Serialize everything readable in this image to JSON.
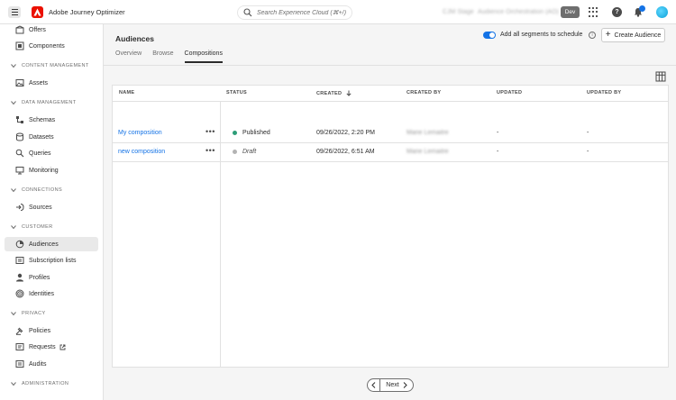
{
  "topbar": {
    "app_title": "Adobe Journey Optimizer",
    "search_placeholder": "Search Experience Cloud (⌘+/)",
    "org_name": "CJM Stage",
    "sandbox_name": "Audience Orchestration (AO)",
    "env_badge": "Dev",
    "icons": [
      "menu-icon",
      "adobe-logo",
      "search-icon",
      "apps-icon",
      "help-icon",
      "bell-icon",
      "avatar"
    ],
    "colors": {
      "adobe_red": "#eb1000",
      "accent_blue": "#1473e6"
    }
  },
  "sidebar": {
    "items_top": [
      {
        "label": "Offers",
        "icon": "offers-icon"
      },
      {
        "label": "Components",
        "icon": "components-icon"
      }
    ],
    "sections": [
      {
        "title": "CONTENT MANAGEMENT",
        "items": [
          {
            "label": "Assets",
            "icon": "assets-icon"
          }
        ]
      },
      {
        "title": "DATA MANAGEMENT",
        "items": [
          {
            "label": "Schemas",
            "icon": "schemas-icon"
          },
          {
            "label": "Datasets",
            "icon": "datasets-icon"
          },
          {
            "label": "Queries",
            "icon": "queries-icon"
          },
          {
            "label": "Monitoring",
            "icon": "monitoring-icon"
          }
        ]
      },
      {
        "title": "CONNECTIONS",
        "items": [
          {
            "label": "Sources",
            "icon": "sources-icon"
          }
        ]
      },
      {
        "title": "CUSTOMER",
        "items": [
          {
            "label": "Audiences",
            "icon": "audiences-icon",
            "active": true
          },
          {
            "label": "Subscription lists",
            "icon": "subscription-lists-icon"
          },
          {
            "label": "Profiles",
            "icon": "profiles-icon"
          },
          {
            "label": "Identities",
            "icon": "identities-icon"
          }
        ]
      },
      {
        "title": "PRIVACY",
        "items": [
          {
            "label": "Policies",
            "icon": "policies-icon"
          },
          {
            "label": "Requests",
            "icon": "requests-icon"
          },
          {
            "label": "Audits",
            "icon": "audits-icon"
          }
        ]
      },
      {
        "title": "ADMINISTRATION",
        "items": []
      }
    ]
  },
  "main": {
    "title": "Audiences",
    "tabs": [
      {
        "label": "Overview"
      },
      {
        "label": "Browse"
      },
      {
        "label": "Compositions",
        "active": true
      }
    ],
    "schedule_toggle": {
      "label": "Add all segments to schedule",
      "on": true
    },
    "create_button": "Create Audience",
    "table": {
      "columns": [
        "NAME",
        "STATUS",
        "CREATED",
        "CREATED BY",
        "UPDATED",
        "UPDATED BY"
      ],
      "sort_column": "CREATED",
      "sort_direction": "descending",
      "rows": [
        {
          "name": "My composition",
          "actions": "•••",
          "status": "Published",
          "status_color": "#2d9d78",
          "created": "09/26/2022, 2:20 PM",
          "created_by": "Marie Lemaitre",
          "updated": "-",
          "updated_by": "-"
        },
        {
          "name": "new composition",
          "actions": "•••",
          "status": "Draft",
          "status_color": "#b3b3b3",
          "created": "09/26/2022, 6:51 AM",
          "created_by": "Marie Lemaitre",
          "updated": "-",
          "updated_by": "-"
        }
      ]
    },
    "pager": {
      "next_label": "Next"
    }
  }
}
